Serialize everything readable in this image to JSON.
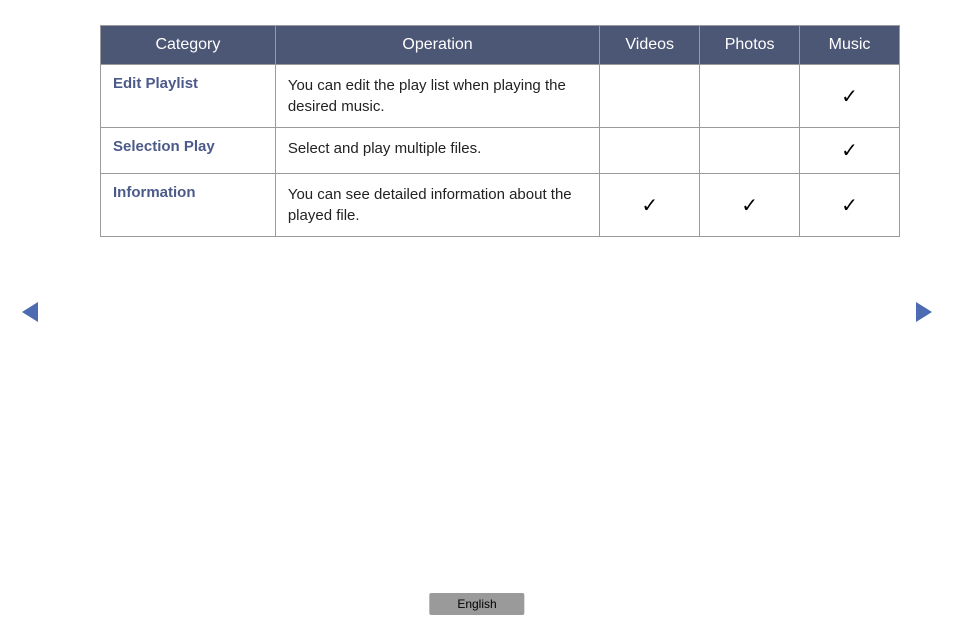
{
  "table": {
    "headers": {
      "category": "Category",
      "operation": "Operation",
      "videos": "Videos",
      "photos": "Photos",
      "music": "Music"
    },
    "rows": [
      {
        "category": "Edit Playlist",
        "operation": "You can edit the play list when playing the desired music.",
        "videos": "",
        "photos": "",
        "music": "✓"
      },
      {
        "category": "Selection Play",
        "operation": "Select and play multiple files.",
        "videos": "",
        "photos": "",
        "music": "✓"
      },
      {
        "category": "Information",
        "operation": "You can see detailed information about the played file.",
        "videos": "✓",
        "photos": "✓",
        "music": "✓"
      }
    ]
  },
  "language": "English"
}
